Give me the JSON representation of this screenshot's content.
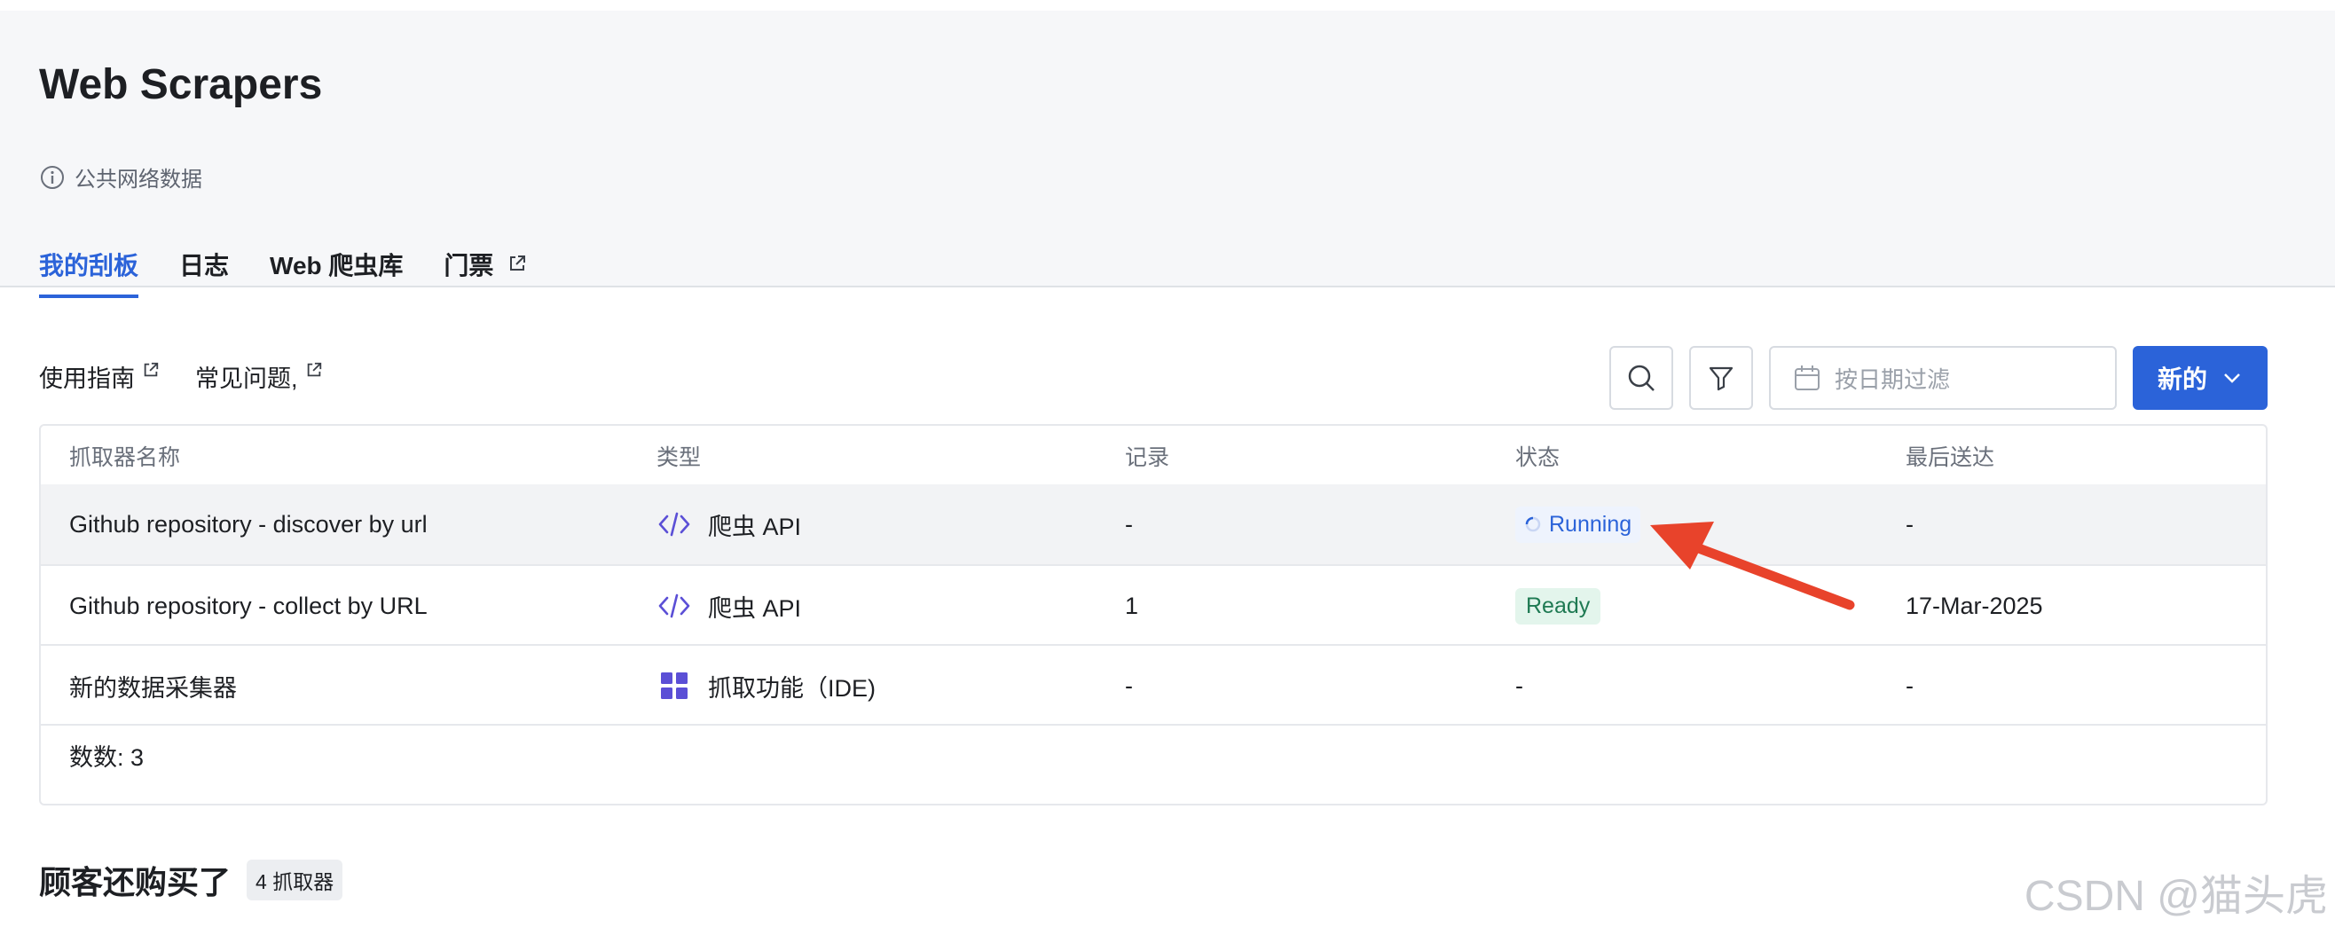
{
  "header": {
    "title": "Web Scrapers",
    "subtitle": "公共网络数据",
    "tabs": [
      {
        "label": "我的刮板"
      },
      {
        "label": "日志"
      },
      {
        "label": "Web 爬虫库"
      },
      {
        "label": "门票"
      }
    ]
  },
  "links": {
    "guide": "使用指南",
    "faq": "常见问题,"
  },
  "toolbar": {
    "date_placeholder": "按日期过滤",
    "new_label": "新的"
  },
  "table": {
    "columns": [
      "抓取器名称",
      "类型",
      "记录",
      "状态",
      "最后送达"
    ],
    "rows": [
      {
        "name": "Github repository - discover by url",
        "type": "爬虫 API",
        "records": "-",
        "status": "Running",
        "last": "-"
      },
      {
        "name": "Github repository - collect by URL",
        "type": "爬虫 API",
        "records": "1",
        "status": "Ready",
        "last": "17-Mar-2025"
      },
      {
        "name": "新的数据采集器",
        "type": "抓取功能（IDE)",
        "records": "-",
        "status": "-",
        "last": "-"
      }
    ],
    "count_label": "数数: 3"
  },
  "section": {
    "title": "顾客还购买了",
    "badge": "4 抓取器"
  },
  "watermark": "CSDN @猫头虎",
  "colors": {
    "accent": "#2b63d9",
    "running": "#2b63d9",
    "ready": "#1f7a53",
    "arrow": "#e8432b"
  }
}
